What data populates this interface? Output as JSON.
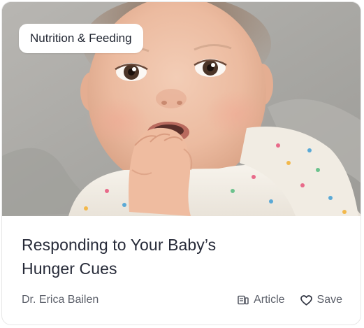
{
  "card": {
    "category": "Nutrition & Feeding",
    "title": "Responding to Your Baby’s Hunger Cues",
    "author": "Dr. Erica Bailen",
    "content_type": "Article",
    "save_label": "Save",
    "image_subject": "baby-chewing-hand-photo"
  },
  "icons": {
    "content_type": "article-icon",
    "save": "heart-outline-icon"
  },
  "colors": {
    "title": "#262a38",
    "meta": "#5b5f69",
    "tag_bg": "#ffffff",
    "card_border": "#e6e6e6"
  }
}
